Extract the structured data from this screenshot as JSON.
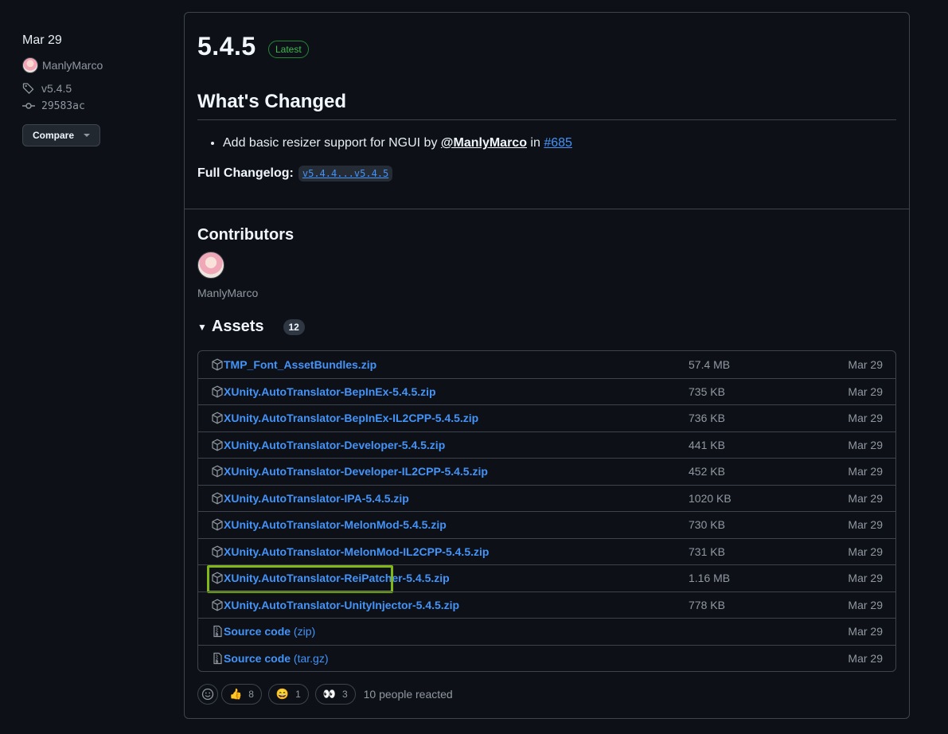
{
  "meta": {
    "date": "Mar 29",
    "author": "ManlyMarco",
    "tag": "v5.4.5",
    "commit": "29583ac",
    "compare_label": "Compare"
  },
  "release": {
    "title": "5.4.5",
    "badge": "Latest",
    "whats_changed": "What's Changed",
    "bullet": {
      "text": "Add basic resizer support for NGUI by ",
      "mention": "@ManlyMarco",
      "in": " in ",
      "pr": "#685"
    },
    "full_changelog_label": "Full Changelog:",
    "full_changelog_range": "v5.4.4...v5.4.5"
  },
  "contributors": {
    "heading": "Contributors",
    "name": "ManlyMarco"
  },
  "assets": {
    "heading": "Assets",
    "count": "12",
    "items": [
      {
        "name": "TMP_Font_AssetBundles.zip",
        "suffix": "",
        "size": "57.4 MB",
        "date": "Mar 29"
      },
      {
        "name": "XUnity.AutoTranslator-BepInEx-5.4.5.zip",
        "suffix": "",
        "size": "735 KB",
        "date": "Mar 29"
      },
      {
        "name": "XUnity.AutoTranslator-BepInEx-IL2CPP-5.4.5.zip",
        "suffix": "",
        "size": "736 KB",
        "date": "Mar 29"
      },
      {
        "name": "XUnity.AutoTranslator-Developer-5.4.5.zip",
        "suffix": "",
        "size": "441 KB",
        "date": "Mar 29"
      },
      {
        "name": "XUnity.AutoTranslator-Developer-IL2CPP-5.4.5.zip",
        "suffix": "",
        "size": "452 KB",
        "date": "Mar 29"
      },
      {
        "name": "XUnity.AutoTranslator-IPA-5.4.5.zip",
        "suffix": "",
        "size": "1020 KB",
        "date": "Mar 29"
      },
      {
        "name": "XUnity.AutoTranslator-MelonMod-5.4.5.zip",
        "suffix": "",
        "size": "730 KB",
        "date": "Mar 29"
      },
      {
        "name": "XUnity.AutoTranslator-MelonMod-IL2CPP-5.4.5.zip",
        "suffix": "",
        "size": "731 KB",
        "date": "Mar 29"
      },
      {
        "name": "XUnity.AutoTranslator-ReiPatcher-5.4.5.zip",
        "suffix": "",
        "size": "1.16 MB",
        "date": "Mar 29"
      },
      {
        "name": "XUnity.AutoTranslator-UnityInjector-5.4.5.zip",
        "suffix": "",
        "size": "778 KB",
        "date": "Mar 29"
      },
      {
        "name": "Source code",
        "suffix": " (zip)",
        "size": "",
        "date": "Mar 29"
      },
      {
        "name": "Source code",
        "suffix": " (tar.gz)",
        "size": "",
        "date": "Mar 29"
      }
    ]
  },
  "reactions": {
    "items": [
      {
        "emoji": "👍",
        "count": "8"
      },
      {
        "emoji": "😄",
        "count": "1"
      },
      {
        "emoji": "👀",
        "count": "3"
      }
    ],
    "summary": "10 people reacted"
  },
  "colors": {
    "accent_link": "#4493f8",
    "latest_green": "#3fb950",
    "highlight_box": "#82b816"
  }
}
